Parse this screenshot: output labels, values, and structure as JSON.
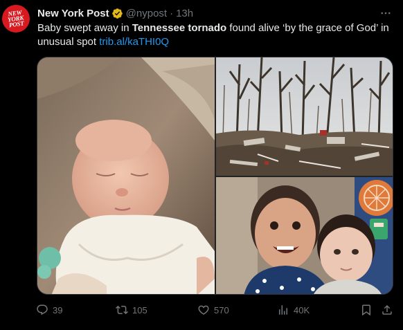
{
  "tweet": {
    "avatar": {
      "lines": [
        "NEW",
        "YORK",
        "POST"
      ],
      "bg": "#d71920"
    },
    "display_name": "New York Post",
    "handle": "@nypost",
    "separator": "·",
    "time": "13h",
    "text": {
      "part1": "Baby swept away in ",
      "bold": "Tennessee tornado",
      "part2": " found alive ‘by the grace of God’ in unusual spot ",
      "link": "trib.al/kaTHI0Q"
    },
    "media": [
      {
        "name": "baby-photo"
      },
      {
        "name": "tornado-debris-photo"
      },
      {
        "name": "two-children-photo"
      }
    ],
    "actions": {
      "replies": "39",
      "retweets": "105",
      "likes": "570",
      "views": "40K"
    }
  },
  "colors": {
    "background": "#000000",
    "text": "#e7e9ea",
    "secondary": "#71767b",
    "link": "#1d9bf0",
    "verified_badge": "#e2b719"
  },
  "icons": [
    "verified-badge-icon",
    "more-icon",
    "reply-icon",
    "retweet-icon",
    "like-icon",
    "views-icon",
    "bookmark-icon",
    "share-icon"
  ]
}
